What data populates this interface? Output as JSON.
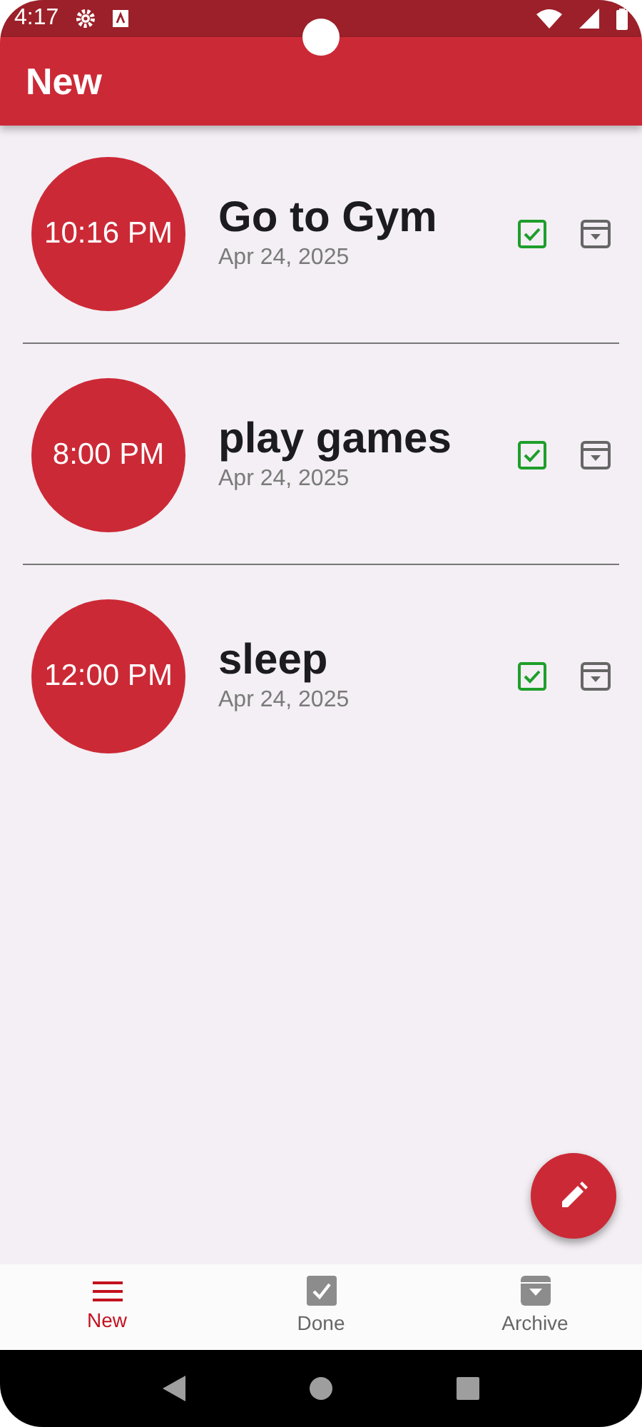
{
  "status_bar": {
    "time": "4:17"
  },
  "app_bar": {
    "title": "New"
  },
  "tasks": [
    {
      "time": "10:16 PM",
      "title": "Go to Gym",
      "date": "Apr 24, 2025"
    },
    {
      "time": "8:00 PM",
      "title": "play games",
      "date": "Apr 24, 2025"
    },
    {
      "time": "12:00 PM",
      "title": "sleep",
      "date": "Apr 24, 2025"
    }
  ],
  "bottom_nav": [
    {
      "label": "New",
      "kind": "list",
      "selected": true
    },
    {
      "label": "Done",
      "kind": "done",
      "selected": false
    },
    {
      "label": "Archive",
      "kind": "archive",
      "selected": false
    }
  ]
}
